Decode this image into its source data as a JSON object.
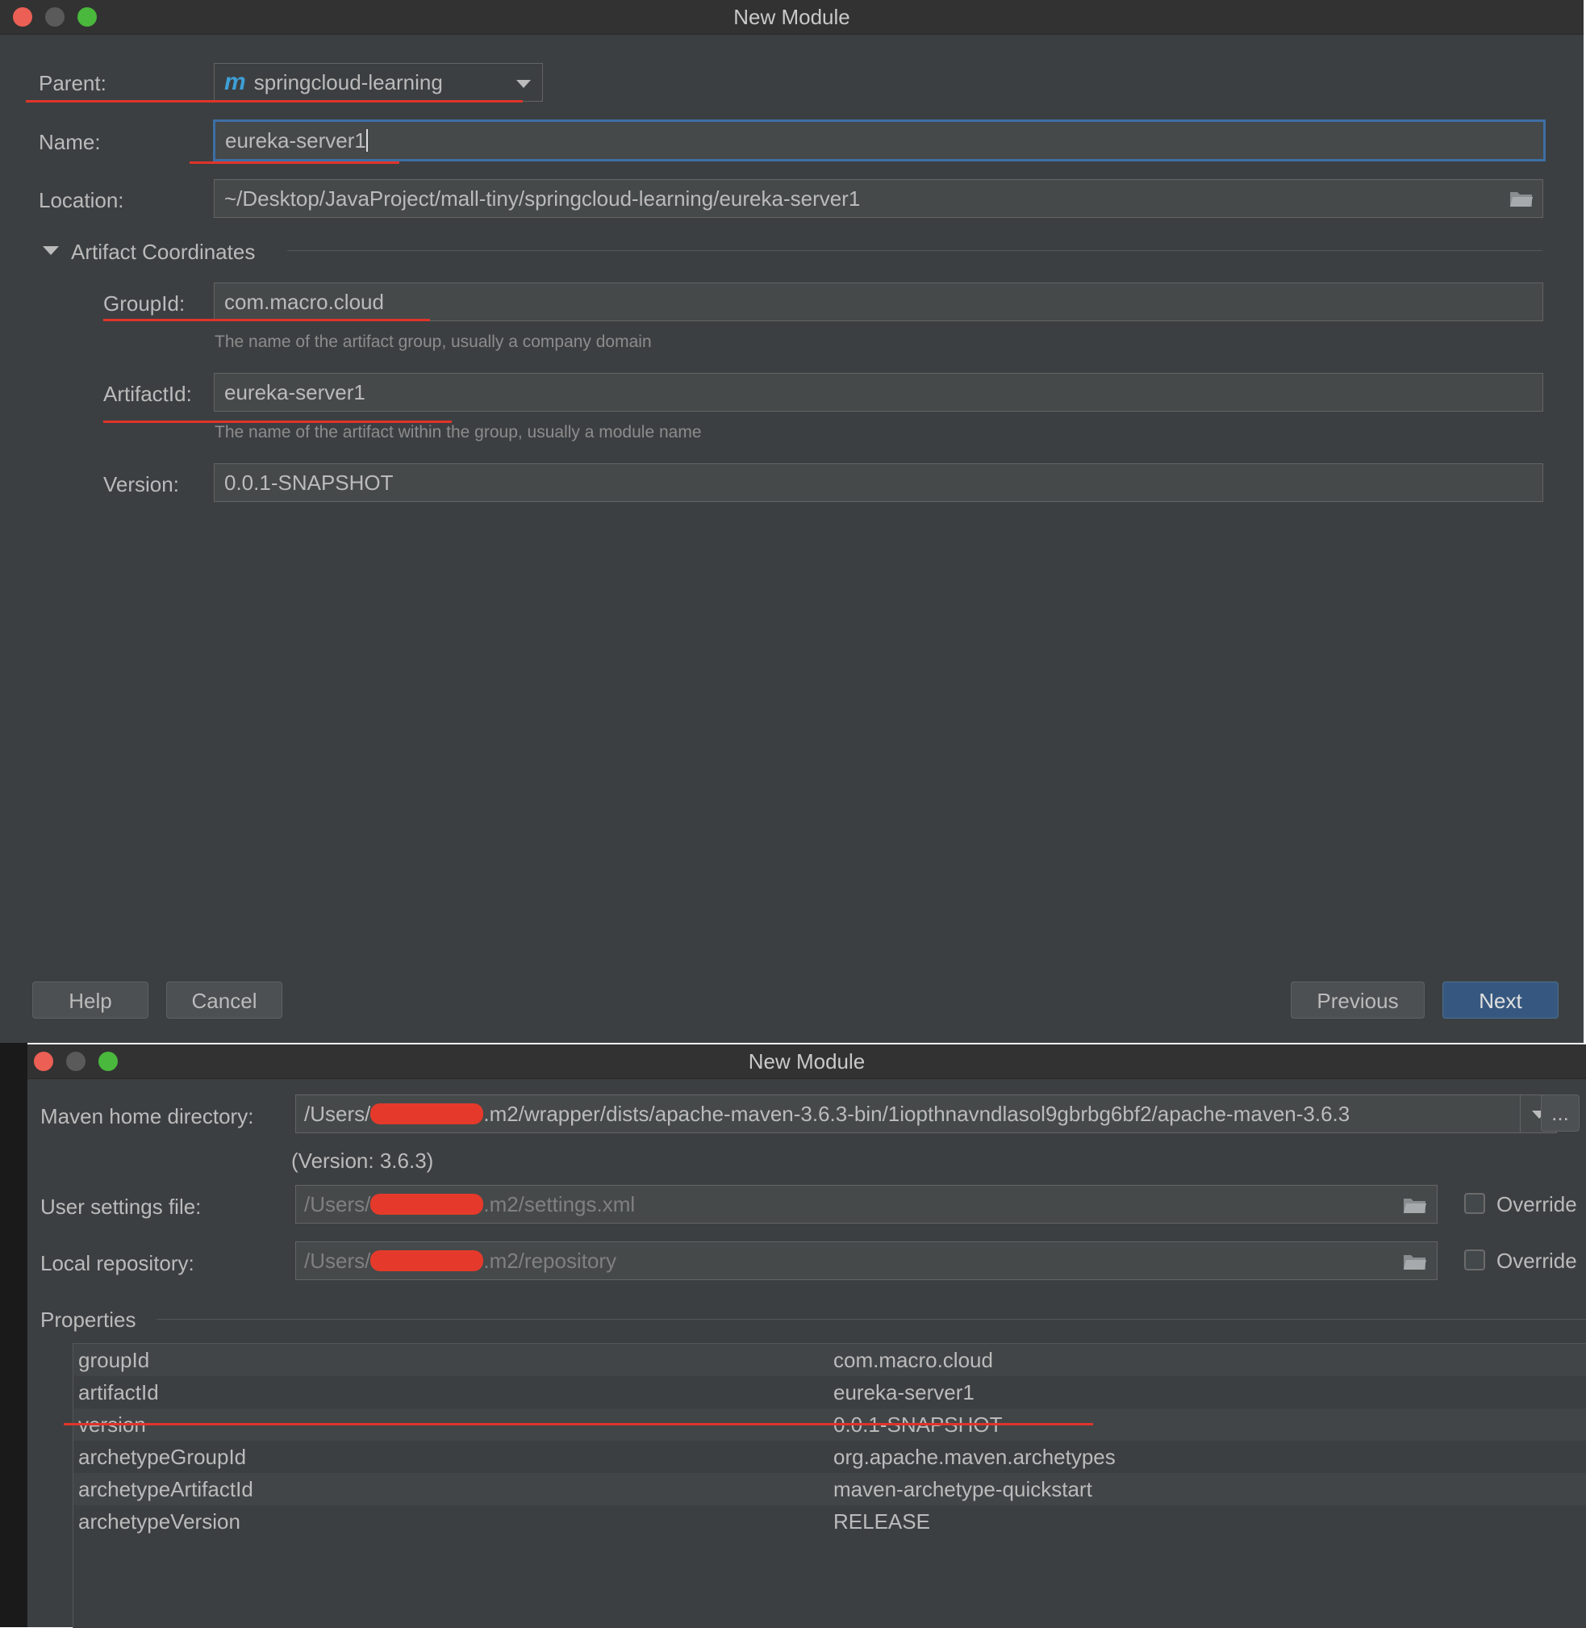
{
  "window1": {
    "title": "New Module",
    "parent_label": "Parent:",
    "parent_value": "springcloud-learning",
    "parent_icon": "maven-m-icon",
    "name_label": "Name:",
    "name_value": "eureka-server1",
    "location_label": "Location:",
    "location_value": "~/Desktop/JavaProject/mall-tiny/springcloud-learning/eureka-server1",
    "section_title": "Artifact Coordinates",
    "groupid_label": "GroupId:",
    "groupid_value": "com.macro.cloud",
    "groupid_hint": "The name of the artifact group, usually a company domain",
    "artifactid_label": "ArtifactId:",
    "artifactid_value": "eureka-server1",
    "artifactid_hint": "The name of the artifact within the group, usually a module name",
    "version_label": "Version:",
    "version_value": "0.0.1-SNAPSHOT",
    "buttons": {
      "help": "Help",
      "cancel": "Cancel",
      "previous": "Previous",
      "next": "Next"
    }
  },
  "window2": {
    "title": "New Module",
    "maven_home_label": "Maven home directory:",
    "maven_home_prefix": "/Users/",
    "maven_home_suffix": ".m2/wrapper/dists/apache-maven-3.6.3-bin/1iopthnavndlasol9gbrbg6bf2/apache-maven-3.6.3",
    "maven_version": "(Version: 3.6.3)",
    "ellipsis": "...",
    "user_settings_label": "User settings file:",
    "user_settings_prefix": "/Users/",
    "user_settings_suffix": ".m2/settings.xml",
    "local_repo_label": "Local repository:",
    "local_repo_prefix": "/Users/",
    "local_repo_suffix": ".m2/repository",
    "override_label": "Override",
    "properties_title": "Properties",
    "properties": [
      {
        "key": "groupId",
        "value": "com.macro.cloud"
      },
      {
        "key": "artifactId",
        "value": "eureka-server1"
      },
      {
        "key": "version",
        "value": "0.0.1-SNAPSHOT"
      },
      {
        "key": "archetypeGroupId",
        "value": "org.apache.maven.archetypes"
      },
      {
        "key": "archetypeArtifactId",
        "value": "maven-archetype-quickstart"
      },
      {
        "key": "archetypeVersion",
        "value": "RELEASE"
      }
    ]
  },
  "colors": {
    "window_bg": "#3c3f41",
    "field_bg": "#45494a",
    "focus_border": "#3d6fa5",
    "annotation_red": "#e0342a",
    "primary_button": "#365880"
  }
}
